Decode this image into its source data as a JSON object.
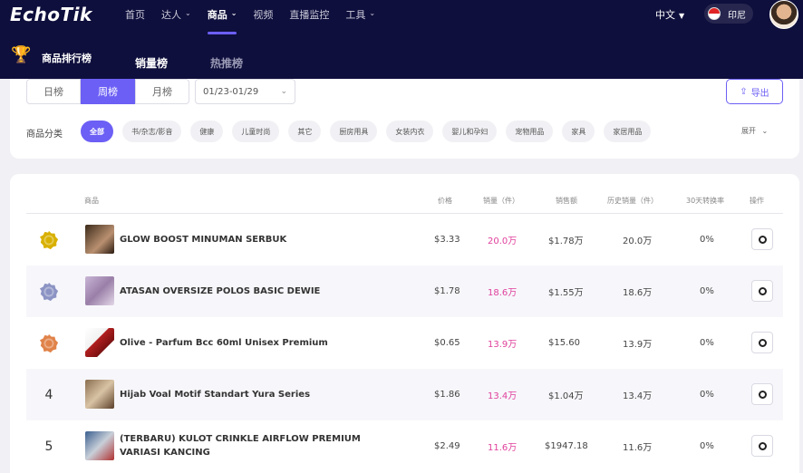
{
  "header": {
    "logo": "EchoTik",
    "nav": [
      {
        "label": "首页",
        "caret": false,
        "active": false
      },
      {
        "label": "达人",
        "caret": true,
        "active": false
      },
      {
        "label": "商品",
        "caret": true,
        "active": true
      },
      {
        "label": "视频",
        "caret": false,
        "active": false
      },
      {
        "label": "直播监控",
        "caret": false,
        "active": false
      },
      {
        "label": "工具",
        "caret": true,
        "active": false
      }
    ],
    "language": "中文",
    "region": "印尼"
  },
  "subnav": {
    "title": "商品排行榜",
    "tabs": [
      "销量榜",
      "热推榜"
    ]
  },
  "filters": {
    "periods": [
      "日榜",
      "周榜",
      "月榜"
    ],
    "active_period": "周榜",
    "date_range": "01/23-01/29",
    "export_label": "导出",
    "category_label": "商品分类",
    "categories": [
      "全部",
      "书/杂志/影音",
      "健康",
      "儿童时尚",
      "其它",
      "厨房用具",
      "女装内衣",
      "婴儿和孕妇",
      "宠物用品",
      "家具",
      "家居用品"
    ],
    "expand_label": "展开"
  },
  "table": {
    "headers": {
      "product": "商品",
      "price": "价格",
      "sales": "销量（件）",
      "revenue": "销售额",
      "history": "历史销量（件）",
      "conversion": "30天转换率",
      "action": "操作"
    },
    "rows": [
      {
        "rank": "1",
        "name": "GLOW BOOST MINUMAN SERBUK",
        "price": "$3.33",
        "sales": "20.0万",
        "revenue": "$1.78万",
        "history": "20.0万",
        "conversion": "0%"
      },
      {
        "rank": "2",
        "name": "ATASAN OVERSIZE POLOS BASIC DEWIE",
        "price": "$1.78",
        "sales": "18.6万",
        "revenue": "$1.55万",
        "history": "18.6万",
        "conversion": "0%"
      },
      {
        "rank": "3",
        "name": "Olive - Parfum Bcc 60ml Unisex Premium",
        "price": "$0.65",
        "sales": "13.9万",
        "revenue": "$15.60",
        "history": "13.9万",
        "conversion": "0%"
      },
      {
        "rank": "4",
        "name": "Hijab Voal Motif Standart Yura Series",
        "price": "$1.86",
        "sales": "13.4万",
        "revenue": "$1.04万",
        "history": "13.4万",
        "conversion": "0%"
      },
      {
        "rank": "5",
        "name": "(TERBARU) KULOT CRINKLE AIRFLOW PREMIUM VARIASI KANCING",
        "price": "$2.49",
        "sales": "11.6万",
        "revenue": "$1947.18",
        "history": "11.6万",
        "conversion": "0%"
      }
    ]
  },
  "colors": {
    "header_bg": "#0f0f3d",
    "accent": "#6c5ff5",
    "sales_pink": "#e0409c",
    "medal_gold": "#d8b000",
    "medal_silver": "#8c94c4",
    "medal_bronze": "#e0834a"
  }
}
